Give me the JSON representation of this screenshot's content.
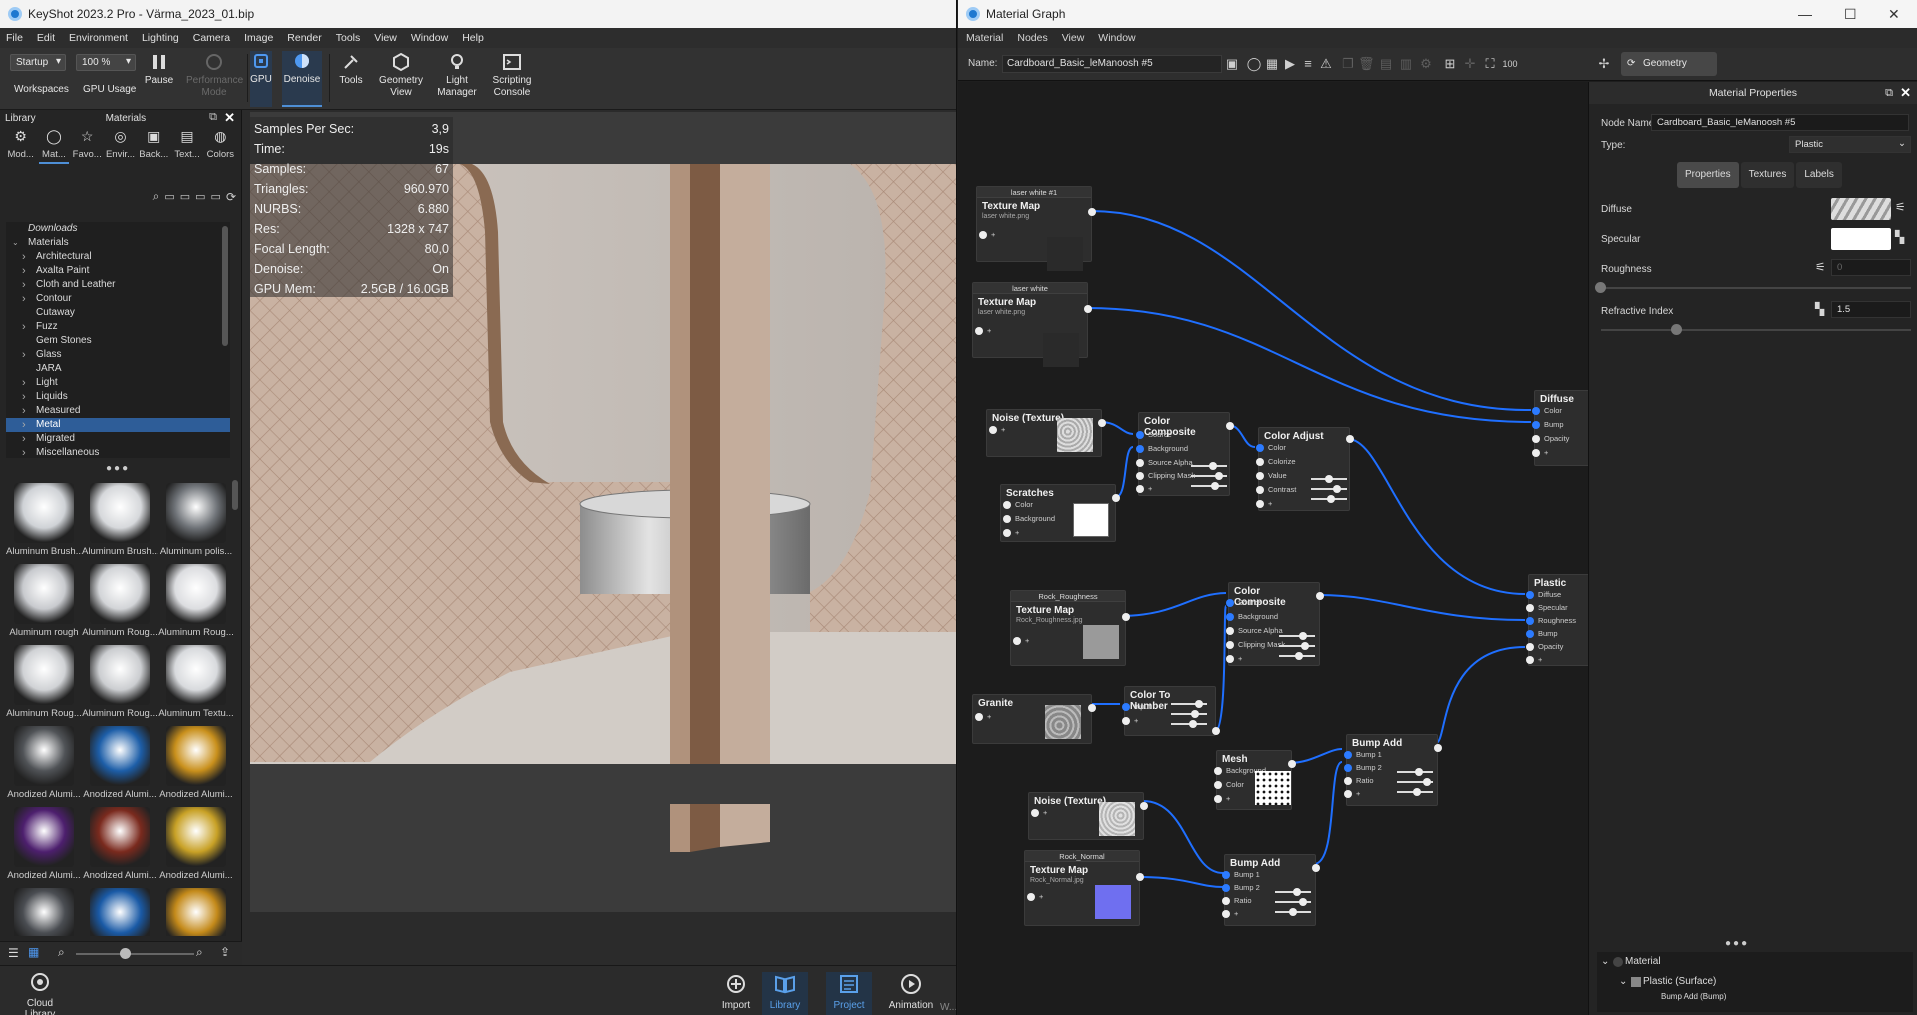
{
  "keyshot": {
    "title": "KeyShot 2023.2 Pro  - Värma_2023_01.bip",
    "menu": [
      "File",
      "Edit",
      "Environment",
      "Lighting",
      "Camera",
      "Image",
      "Render",
      "Tools",
      "View",
      "Window",
      "Help"
    ],
    "ribbon": {
      "workspace_value": "Startup",
      "zoom_value": "100 %",
      "workspaces": "Workspaces",
      "gpu_usage": "GPU Usage",
      "pause": "Pause",
      "performance_mode": "Performance Mode",
      "gpu": "GPU",
      "denoise": "Denoise",
      "tools": "Tools",
      "geometry_view": "Geometry View",
      "light_manager": "Light Manager",
      "scripting_console": "Scripting Console"
    },
    "library": {
      "title": "Library",
      "materials_title": "Materials",
      "categories": [
        "Mod...",
        "Mat...",
        "Favo...",
        "Envir...",
        "Back...",
        "Text...",
        "Colors"
      ],
      "tree_root_downloads": "Downloads",
      "tree_root_materials": "Materials",
      "tree": [
        {
          "label": "Architectural",
          "arrow": true
        },
        {
          "label": "Axalta Paint",
          "arrow": true
        },
        {
          "label": "Cloth and Leather",
          "arrow": true
        },
        {
          "label": "Contour",
          "arrow": true
        },
        {
          "label": "Cutaway",
          "arrow": false
        },
        {
          "label": "Fuzz",
          "arrow": true
        },
        {
          "label": "Gem Stones",
          "arrow": false
        },
        {
          "label": "Glass",
          "arrow": true
        },
        {
          "label": "JARA",
          "arrow": false
        },
        {
          "label": "Light",
          "arrow": true
        },
        {
          "label": "Liquids",
          "arrow": true
        },
        {
          "label": "Measured",
          "arrow": true
        },
        {
          "label": "Metal",
          "arrow": true,
          "selected": true
        },
        {
          "label": "Migrated",
          "arrow": true
        },
        {
          "label": "Miscellaneous",
          "arrow": true
        }
      ],
      "thumbnails": [
        {
          "label": "Aluminum Brush...",
          "color": "#cfd2d6"
        },
        {
          "label": "Aluminum Brush...",
          "color": "#d6d8db"
        },
        {
          "label": "Aluminum polis...",
          "color": "#6f7378"
        },
        {
          "label": "Aluminum rough",
          "color": "#c8cace"
        },
        {
          "label": "Aluminum Roug...",
          "color": "#d2d4d7"
        },
        {
          "label": "Aluminum Roug...",
          "color": "#dcdde0"
        },
        {
          "label": "Aluminum Roug...",
          "color": "#d0d2d5"
        },
        {
          "label": "Aluminum Roug...",
          "color": "#cbcdd0"
        },
        {
          "label": "Aluminum Textu...",
          "color": "#d8dadd"
        },
        {
          "label": "Anodized Alumi...",
          "color": "#505357"
        },
        {
          "label": "Anodized Alumi...",
          "color": "#1d5ea8"
        },
        {
          "label": "Anodized Alumi...",
          "color": "#c9901c"
        },
        {
          "label": "Anodized Alumi...",
          "color": "#4d1f6e"
        },
        {
          "label": "Anodized Alumi...",
          "color": "#7a2a1e"
        },
        {
          "label": "Anodized Alumi...",
          "color": "#c8a126"
        },
        {
          "label": "",
          "color": "#4a4d52"
        },
        {
          "label": "",
          "color": "#1a5aa6"
        },
        {
          "label": "",
          "color": "#c48a1a"
        }
      ]
    },
    "stats": [
      {
        "k": "Samples Per Sec:",
        "v": "3,9"
      },
      {
        "k": "Time:",
        "v": "19s"
      },
      {
        "k": "Samples:",
        "v": "67"
      },
      {
        "k": "Triangles:",
        "v": "960.970"
      },
      {
        "k": "NURBS:",
        "v": "6.880"
      },
      {
        "k": "Res:",
        "v": "1328 x 747"
      },
      {
        "k": "Focal Length:",
        "v": "80,0"
      },
      {
        "k": "Denoise:",
        "v": "On"
      },
      {
        "k": "GPU Mem:",
        "v": "2.5GB / 16.0GB"
      }
    ],
    "bottom": {
      "cloud_library": "Cloud Library",
      "import": "Import",
      "library": "Library",
      "project": "Project",
      "animation": "Animation",
      "partial": "W..."
    }
  },
  "material_graph": {
    "title": "Material Graph",
    "menu": [
      "Material",
      "Nodes",
      "View",
      "Window"
    ],
    "name_label": "Name:",
    "name_value": "Cardboard_Basic_leManoosh #5",
    "geometry_nodes": "Geometry Nodes",
    "nodes": {
      "tex1_header": "laser white #1",
      "tex1_title": "Texture Map",
      "tex1_file": "laser white.png",
      "tex2_header": "laser white",
      "tex2_title": "Texture Map",
      "tex2_file": "laser white.png",
      "noise1": "Noise (Texture)",
      "scratches": "Scratches",
      "cc1": "Color Composite",
      "cadj": "Color Adjust",
      "diffuse": "Diffuse",
      "rock_header": "Rock_Roughness",
      "rock_title": "Texture Map",
      "rock_file": "Rock_Roughness.jpg",
      "cc2": "Color Composite",
      "plastic": "Plastic",
      "granite": "Granite",
      "ctn": "Color To Number",
      "mesh": "Mesh",
      "bump1": "Bump Add",
      "noise2": "Noise (Texture)",
      "rnorm_header": "Rock_Normal",
      "rnorm_title": "Texture Map",
      "rnorm_file": "Rock_Normal.jpg",
      "bump2": "Bump Add"
    },
    "pins": {
      "color": "Color",
      "bump": "Bump",
      "opacity": "Opacity",
      "plus": "+",
      "source": "Source",
      "background": "Background",
      "source_alpha": "Source Alpha",
      "clipping_mask": "Clipping Mask",
      "colorize": "Colorize",
      "value": "Value",
      "contrast": "Contrast",
      "diffuse": "Diffuse",
      "specular": "Specular",
      "roughness": "Roughness",
      "input": "Input",
      "bump1": "Bump 1",
      "bump2": "Bump 2",
      "ratio": "Ratio"
    },
    "props": {
      "title": "Material Properties",
      "node_name_label": "Node Name:",
      "node_name_value": "Cardboard_Basic_leManoosh #5",
      "type_label": "Type:",
      "type_value": "Plastic",
      "tabs": [
        "Properties",
        "Textures",
        "Labels"
      ],
      "diffuse": "Diffuse",
      "specular": "Specular",
      "roughness": "Roughness",
      "roughness_value": "0",
      "refractive_index": "Refractive Index",
      "refractive_value": "1.5",
      "tree_material": "Material",
      "tree_plastic": "Plastic (Surface)",
      "tree_bump": "Bump Add (Bump)"
    }
  }
}
